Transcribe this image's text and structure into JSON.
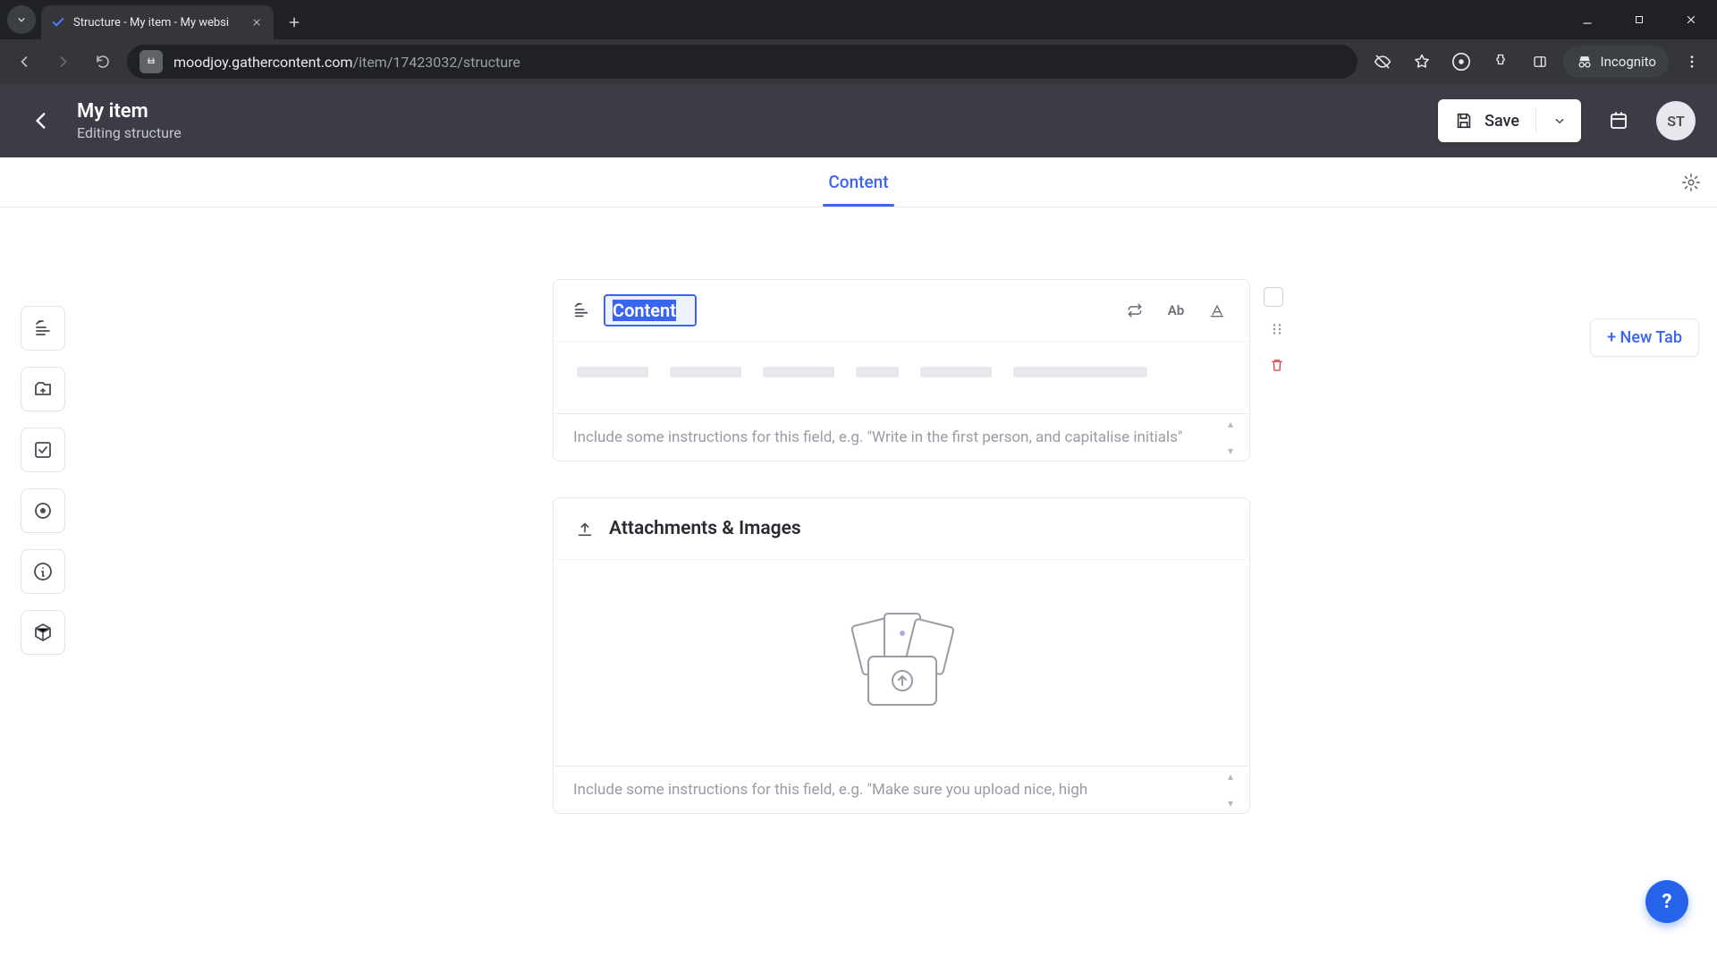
{
  "browser": {
    "tab_title": "Structure - My item - My websi",
    "url_host": "moodjoy.gathercontent.com",
    "url_path": "/item/17423032/structure",
    "incognito_label": "Incognito"
  },
  "header": {
    "title": "My item",
    "subtitle": "Editing structure",
    "save_label": "Save",
    "avatar_initials": "ST"
  },
  "tabnav": {
    "active_tab": "Content",
    "new_tab_label": "+ New Tab"
  },
  "content_field": {
    "name_value": "Content",
    "instructions_placeholder": "Include some instructions for this field, e.g. \"Write in the first person, and capitalise initials\"",
    "tool_ab": "Ab"
  },
  "attachments_field": {
    "title": "Attachments & Images",
    "instructions_placeholder": "Include some instructions for this field, e.g. \"Make sure you upload nice, high"
  },
  "help_label": "?"
}
